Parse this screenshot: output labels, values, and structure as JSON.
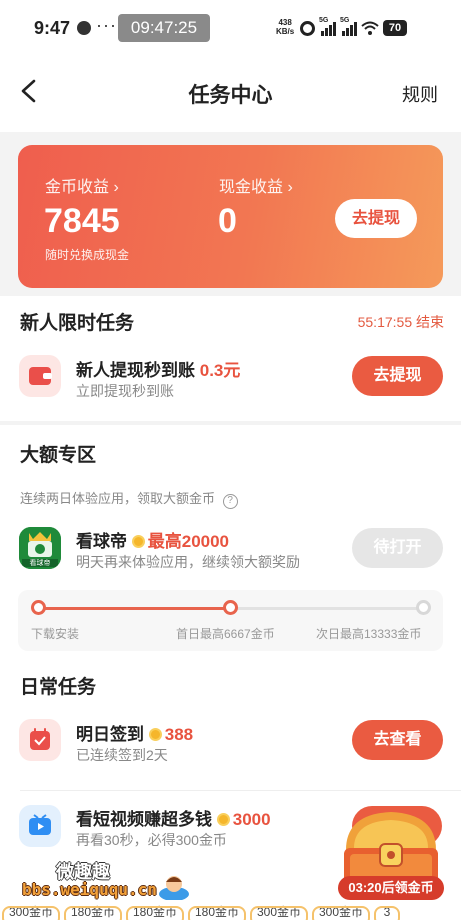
{
  "status_bar": {
    "time": "9:47",
    "more": "···",
    "clock": "09:47:25",
    "speed_value": "438",
    "speed_unit": "KB/s",
    "network": "5G",
    "battery": "70"
  },
  "header": {
    "title": "任务中心",
    "rules": "规则"
  },
  "earnings": {
    "coin_label": "金币收益",
    "coin_value": "7845",
    "coin_sub": "随时兑换成现金",
    "cash_label": "现金收益",
    "cash_value": "0",
    "withdraw_button": "去提现",
    "chevron": "›"
  },
  "newbie": {
    "title": "新人限时任务",
    "countdown": "55:17:55 结束",
    "task": {
      "name": "新人提现秒到账",
      "amount": "0.3元",
      "sub": "立即提现秒到账",
      "button": "去提现"
    }
  },
  "big": {
    "title": "大额专区",
    "desc": "连续两日体验应用，领取大额金币",
    "help_icon": "?",
    "app": {
      "name": "看球帝",
      "icon_text": "看球帝",
      "reward": "最高20000",
      "sub": "明天再来体验应用，继续领大额奖励",
      "button": "待打开"
    },
    "progress": {
      "steps": [
        "下载安装",
        "首日最高6667金币",
        "次日最高13333金币"
      ],
      "completed_steps": 2
    }
  },
  "daily": {
    "title": "日常任务",
    "tasks": [
      {
        "name": "明日签到",
        "reward": "388",
        "sub": "已连续签到2天",
        "button": "去查看"
      },
      {
        "name": "看短视频赚超多钱",
        "reward": "3000",
        "sub": "再看30秒，必得300金币"
      }
    ]
  },
  "chest": {
    "timer": "03:20后领金币"
  },
  "watermark": {
    "cn": "微趣趣",
    "url": "bbs.weiququ.cn"
  },
  "bottom_strip": [
    "300金币",
    "180金币",
    "180金币",
    "180金币",
    "300金币",
    "300金币",
    "3"
  ],
  "colors": {
    "accent": "#ea5b41",
    "card_gradient_start": "#ef5e4e",
    "card_gradient_end": "#f59a5a"
  }
}
